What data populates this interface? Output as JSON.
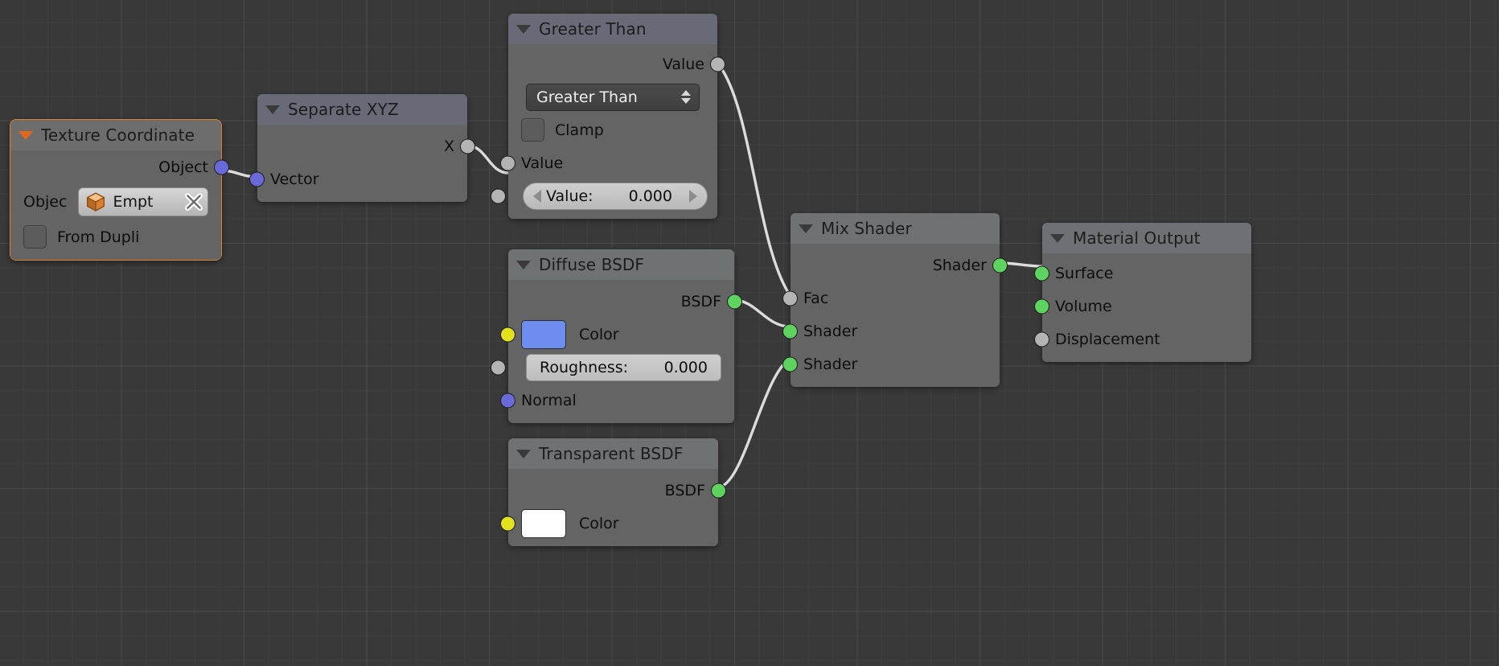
{
  "editor": {
    "name": "blender-shader-node-editor",
    "background": "#393939"
  },
  "colors": {
    "socket_vector": "#6a69d8",
    "socket_value": "#b4b4b4",
    "socket_shader": "#5fd35f",
    "socket_color": "#e2e21f",
    "node_body": "#646464",
    "node_header_shader": "#6f7272",
    "node_header_converter": "#686a78",
    "selection_outline": "#e0802c",
    "diffuse_color_swatch": "#6d8ef0",
    "transparent_color_swatch": "#ffffff",
    "wire": "#d8d8d8"
  },
  "nodes": {
    "texture_coordinate": {
      "title": "Texture Coordinate",
      "selected": true,
      "outputs": [
        {
          "label": "Object",
          "socket": "vector"
        }
      ],
      "object_row": {
        "label": "Objec",
        "value": "Empt",
        "icon": "cube-icon",
        "clear_icon": "x-icon"
      },
      "from_dupli": {
        "label": "From Dupli",
        "checked": false
      }
    },
    "separate_xyz": {
      "title": "Separate XYZ",
      "outputs": [
        {
          "label": "X",
          "socket": "value"
        }
      ],
      "inputs": [
        {
          "label": "Vector",
          "socket": "vector"
        }
      ]
    },
    "greater_than": {
      "title": "Greater Than",
      "outputs": [
        {
          "label": "Value",
          "socket": "value"
        }
      ],
      "operation": {
        "selected": "Greater Than",
        "icon": "chevron-updown-icon"
      },
      "clamp": {
        "label": "Clamp",
        "checked": false
      },
      "inputs": [
        {
          "label": "Value",
          "socket": "value",
          "widget": null
        },
        {
          "label": "Value:",
          "socket": "value",
          "widget": "slider",
          "value": "0.000"
        }
      ]
    },
    "diffuse_bsdf": {
      "title": "Diffuse BSDF",
      "outputs": [
        {
          "label": "BSDF",
          "socket": "shader"
        }
      ],
      "inputs": [
        {
          "label": "Color",
          "socket": "color",
          "widget": "swatch",
          "value": "#6d8ef0"
        },
        {
          "label": "Roughness:",
          "socket": "value",
          "widget": "field",
          "value": "0.000"
        },
        {
          "label": "Normal",
          "socket": "vector",
          "widget": null
        }
      ]
    },
    "transparent_bsdf": {
      "title": "Transparent BSDF",
      "outputs": [
        {
          "label": "BSDF",
          "socket": "shader"
        }
      ],
      "inputs": [
        {
          "label": "Color",
          "socket": "color",
          "widget": "swatch",
          "value": "#ffffff"
        }
      ]
    },
    "mix_shader": {
      "title": "Mix Shader",
      "outputs": [
        {
          "label": "Shader",
          "socket": "shader"
        }
      ],
      "inputs": [
        {
          "label": "Fac",
          "socket": "value"
        },
        {
          "label": "Shader",
          "socket": "shader"
        },
        {
          "label": "Shader",
          "socket": "shader"
        }
      ]
    },
    "material_output": {
      "title": "Material Output",
      "inputs": [
        {
          "label": "Surface",
          "socket": "shader"
        },
        {
          "label": "Volume",
          "socket": "shader"
        },
        {
          "label": "Displacement",
          "socket": "value"
        }
      ]
    }
  },
  "links": [
    {
      "from": "texture_coordinate.Object",
      "to": "separate_xyz.Vector"
    },
    {
      "from": "separate_xyz.X",
      "to": "greater_than.Value"
    },
    {
      "from": "greater_than.Value",
      "to": "mix_shader.Fac"
    },
    {
      "from": "diffuse_bsdf.BSDF",
      "to": "mix_shader.Shader1"
    },
    {
      "from": "transparent_bsdf.BSDF",
      "to": "mix_shader.Shader2"
    },
    {
      "from": "mix_shader.Shader",
      "to": "material_output.Surface"
    }
  ]
}
